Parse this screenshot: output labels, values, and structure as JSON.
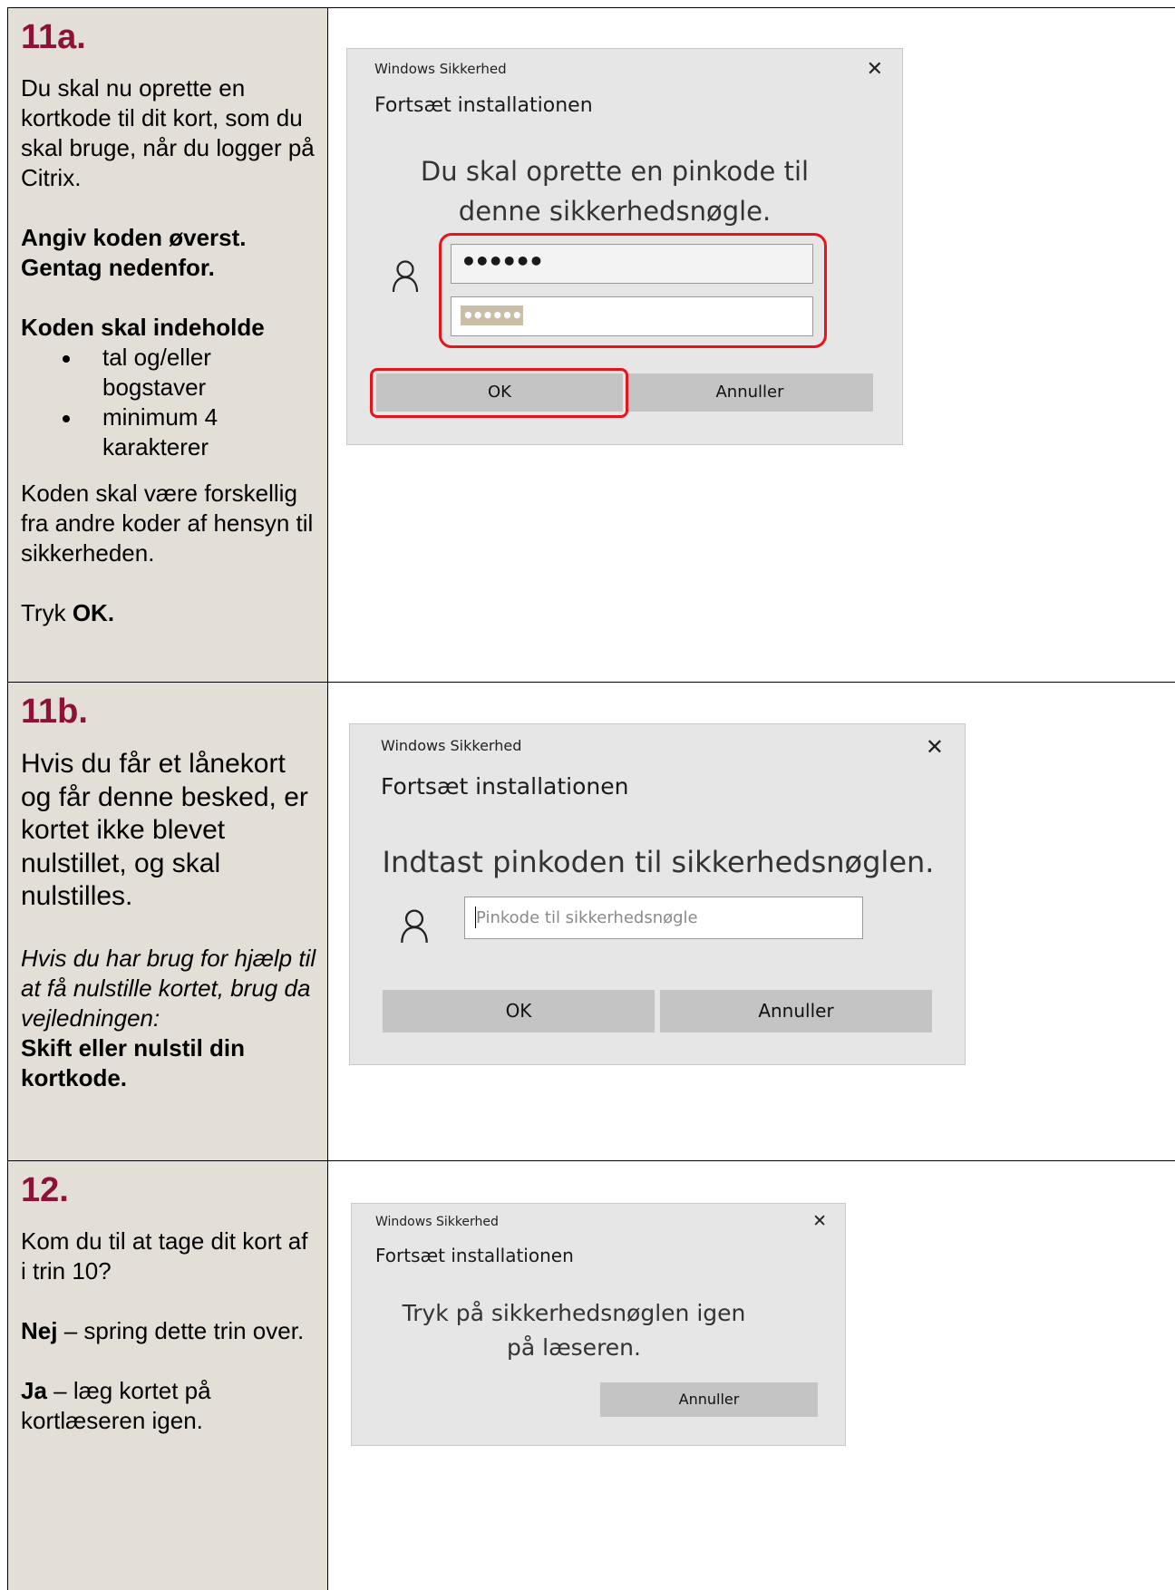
{
  "step11a": {
    "number": "11a.",
    "p1": "Du skal nu oprette en kortkode til dit kort, som du skal bruge, når du logger på Citrix.",
    "bold1": "Angiv koden øverst.",
    "bold2": "Gentag nedenfor.",
    "req_heading": "Koden skal indeholde",
    "bullets": [
      "tal og/eller bogstaver",
      "minimum 4 karakterer"
    ],
    "p2": "Koden skal være forskellig fra andre koder af hensyn til sikkerheden.",
    "tryk": "Tryk ",
    "ok_bold": "OK.",
    "dialog": {
      "title": "Windows Sikkerhed",
      "subtitle": "Fortsæt installationen",
      "message": "Du skal oprette en pinkode til denne sikkerhedsnøgle.",
      "pin_value": "••••••",
      "confirm_value": "••••••",
      "ok": "OK",
      "cancel": "Annuller"
    }
  },
  "step11b": {
    "number": "11b.",
    "p1": "Hvis du får et lånekort og får denne besked, er kortet ikke blevet nulstillet, og skal nulstilles.",
    "p2_italic": "Hvis du har brug for hjælp til at få nulstille kortet, brug da vejledningen:",
    "p2_bold": "Skift eller nulstil din kortkode.",
    "dialog": {
      "title": "Windows Sikkerhed",
      "subtitle": "Fortsæt installationen",
      "message": "Indtast pinkoden til sikkerhedsnøglen.",
      "placeholder": "Pinkode til sikkerhedsnøgle",
      "ok": "OK",
      "cancel": "Annuller"
    }
  },
  "step12": {
    "number": "12.",
    "p1": "Kom du til at tage dit kort af i trin 10?",
    "nej": "Nej",
    "nej_text": " – spring dette trin over.",
    "ja": "Ja",
    "ja_text": " – læg kortet på kortlæseren igen.",
    "dialog": {
      "title": "Windows Sikkerhed",
      "subtitle": "Fortsæt installationen",
      "message": "Tryk på sikkerhedsnøglen igen på læseren.",
      "cancel": "Annuller"
    }
  },
  "colors": {
    "step_number": "#8e1237",
    "left_column": "#e3dfd6",
    "highlight": "#e8141c"
  },
  "icons": [
    "close-icon",
    "person-icon"
  ]
}
